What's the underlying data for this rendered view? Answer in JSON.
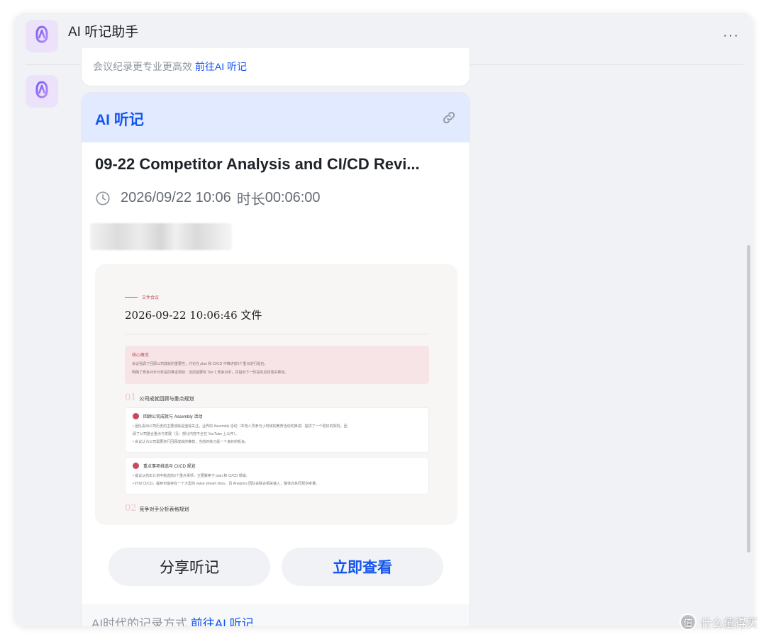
{
  "header": {
    "title": "AI 听记助手",
    "more": "···"
  },
  "prev_card": {
    "text": "会议纪录更专业更高效 前往AI 听记",
    "link": "前往AI 听记"
  },
  "card": {
    "label": "AI 听记",
    "title": "09-22 Competitor Analysis and CI/CD Revi...",
    "date": "2026/09/22 10:06",
    "duration_label": "时长",
    "duration": "00:06:00",
    "preview": {
      "kicker": "文件会议",
      "title": "2026-09-22 10:06:46 文件",
      "summary_head": "核心概览",
      "summary_lines": [
        "会议强调了回顾公司成就的重要性，讨论在 plan 和 CI/CD 中推进前3个重点进行提名。",
        "明确了竞争对手分析是的推进规划：当前首要有 Tier 1 竞争对手，并指出下一阶段的具体落实推动。"
      ],
      "section1_num": "01",
      "section1_title": "公司成就回顾与重点规划",
      "box1_head": "回顾公司成就与 Assembly 活动",
      "box1_lines": [
        "• 团队看出公司历史的主要成就是值得关注，业界的 Assembly 活动（本地人员参与小时候的教育活动的推进）提供了一个很好的契机，回",
        "顾了公司整合重点与发展（见：部分内容不全在 YouTube 上公开）。",
        "• 会议认为公司需要进行回顾成就的推荐，当前的练习是一个良好的机会。"
      ],
      "box2_head": "重点事项挑选与 CI/CD 规划",
      "box2_lines": [
        "• 提议从前年计划中挑选前3个重点事项，主要聚焦于 plan 和 CI/CD 领域。",
        "• 针对 CI/CD，提到可能存在一个大型的 value stream story，且 Analytics 团队会联合相关输入，整体向共同规划考量。"
      ],
      "section2_num": "02",
      "section2_title": "竞争对手分析表格规划"
    },
    "share_button": "分享听记",
    "view_button": "立即查看",
    "footer_text": "AI时代的记录方式",
    "footer_link": "前往AI 听记"
  },
  "watermark": {
    "icon": "值",
    "text": "什么值得买"
  },
  "colors": {
    "accent": "#1456f0",
    "card_header_bg": "#e1eafe",
    "avatar_bg": "#ece3fb",
    "doc_accent": "#c9495b"
  }
}
